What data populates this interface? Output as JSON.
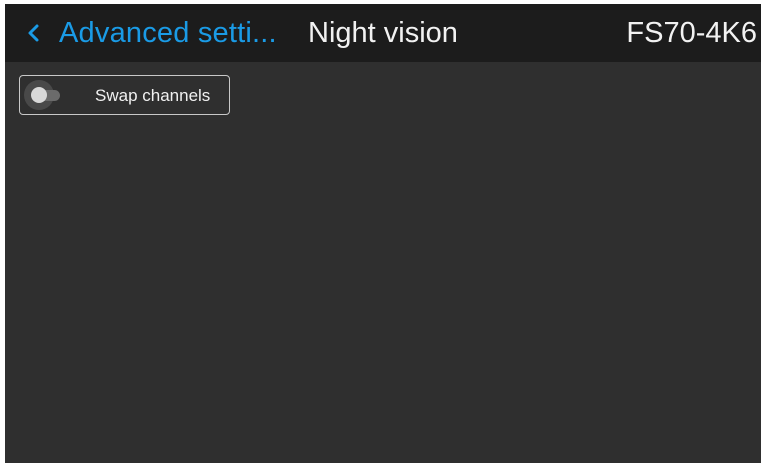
{
  "header": {
    "back_label": "Advanced setti...",
    "title": "Night vision",
    "device": "FS70-4K6"
  },
  "settings": {
    "swap_channels": {
      "label": "Swap channels",
      "enabled": false
    }
  },
  "colors": {
    "accent": "#1a9be6",
    "header_bg": "#1c1c1c",
    "screen_bg": "#2f2f2f",
    "text": "#f2f2f2"
  },
  "icons": {
    "back": "chevron-left-icon"
  }
}
